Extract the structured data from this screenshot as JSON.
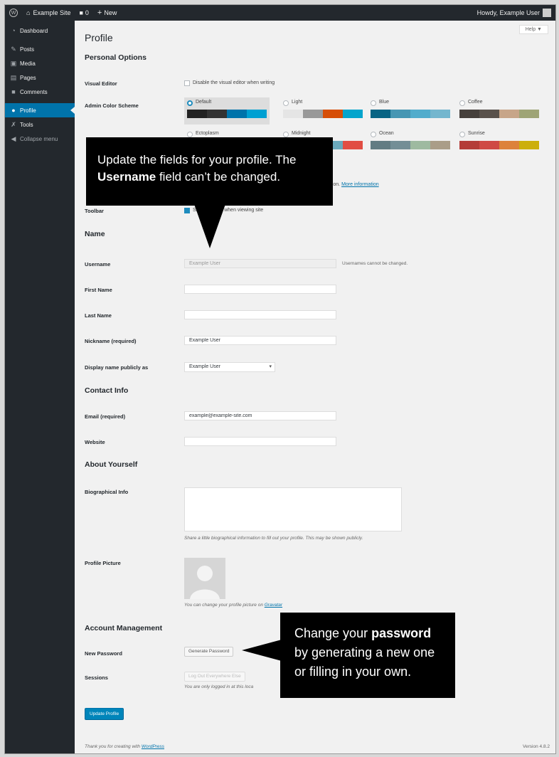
{
  "admin_bar": {
    "site_name": "Example Site",
    "comments_count": "0",
    "new_label": "New",
    "howdy": "Howdy, Example User"
  },
  "sidebar": {
    "items": [
      {
        "label": "Dashboard",
        "icon": "dashboard-icon"
      },
      {
        "label": "Posts",
        "icon": "pin-icon"
      },
      {
        "label": "Media",
        "icon": "media-icon"
      },
      {
        "label": "Pages",
        "icon": "pages-icon"
      },
      {
        "label": "Comments",
        "icon": "comments-icon"
      },
      {
        "label": "Profile",
        "icon": "user-icon",
        "current": true
      },
      {
        "label": "Tools",
        "icon": "wrench-icon"
      },
      {
        "label": "Collapse menu",
        "icon": "collapse-icon"
      }
    ]
  },
  "help_label": "Help ▼",
  "page_title": "Profile",
  "personal_options": {
    "heading": "Personal Options",
    "visual_editor_label": "Visual Editor",
    "visual_editor_checkbox": "Disable the visual editor when writing",
    "color_scheme_label": "Admin Color Scheme",
    "schemes": [
      {
        "name": "Default",
        "selected": true,
        "colors": [
          "#222222",
          "#333333",
          "#0073aa",
          "#00a0d2"
        ]
      },
      {
        "name": "Light",
        "selected": false,
        "colors": [
          "#e5e5e5",
          "#999999",
          "#d64e07",
          "#04a4cc"
        ]
      },
      {
        "name": "Blue",
        "selected": false,
        "colors": [
          "#096484",
          "#4796b3",
          "#52accc",
          "#74b6ce"
        ]
      },
      {
        "name": "Coffee",
        "selected": false,
        "colors": [
          "#46403c",
          "#59524c",
          "#c7a589",
          "#9ea476"
        ]
      },
      {
        "name": "Ectoplasm",
        "selected": false,
        "colors": [
          "#413256",
          "#523f6d",
          "#a3b745",
          "#d46f15"
        ]
      },
      {
        "name": "Midnight",
        "selected": false,
        "colors": [
          "#25282b",
          "#363b3f",
          "#69a8bb",
          "#e14d43"
        ]
      },
      {
        "name": "Ocean",
        "selected": false,
        "colors": [
          "#627c83",
          "#738e96",
          "#9ebaa0",
          "#aa9d88"
        ]
      },
      {
        "name": "Sunrise",
        "selected": false,
        "colors": [
          "#b43c38",
          "#cf4944",
          "#dd823b",
          "#ccaf0b"
        ]
      }
    ],
    "shortcuts_tail": "ation.",
    "more_information": "More information",
    "toolbar_label": "Toolbar",
    "toolbar_checkbox": "Show Toolbar when viewing site"
  },
  "name_section": {
    "heading": "Name",
    "username_label": "Username",
    "username_value": "Example User",
    "username_note": "Usernames cannot be changed.",
    "first_name_label": "First Name",
    "first_name_value": "",
    "last_name_label": "Last Name",
    "last_name_value": "",
    "nickname_label": "Nickname (required)",
    "nickname_value": "Example User",
    "display_name_label": "Display name publicly as",
    "display_name_value": "Example User"
  },
  "contact_section": {
    "heading": "Contact Info",
    "email_label": "Email (required)",
    "email_value": "example@example-site.com",
    "website_label": "Website",
    "website_value": ""
  },
  "about_section": {
    "heading": "About Yourself",
    "bio_label": "Biographical Info",
    "bio_desc": "Share a little biographical information to fill out your profile. This may be shown publicly.",
    "picture_label": "Profile Picture",
    "picture_desc": "You can change your profile picture on",
    "gravatar_link": "Gravatar"
  },
  "account_section": {
    "heading": "Account Management",
    "new_password_label": "New Password",
    "generate_button": "Generate Password",
    "sessions_label": "Sessions",
    "logout_button": "Log Out Everywhere Else",
    "sessions_desc": "You are only logged in at this loca"
  },
  "update_button": "Update Profile",
  "footer": {
    "thanks_prefix": "Thank you for creating with",
    "wordpress_link": "WordPress",
    "version": "Version 4.8.2"
  },
  "callouts": {
    "top_line1": "Update the fields for your profile. The",
    "top_bold": "Username",
    "top_rest": " field can’t be changed.",
    "bottom_line1_prefix": "Change your ",
    "bottom_bold": "password",
    "bottom_line2": "by generating a new one",
    "bottom_line3": "or filling in your own."
  }
}
